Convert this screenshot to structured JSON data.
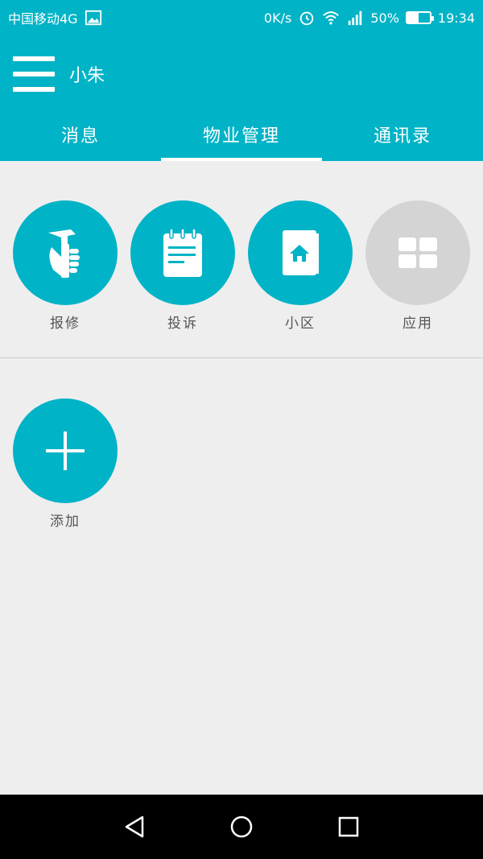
{
  "status_bar": {
    "carrier": "中国移动4G",
    "speed": "0K/s",
    "battery": "50%",
    "battery_level": 0.5,
    "time": "19:34"
  },
  "app_bar": {
    "title": "小朱",
    "tabs": [
      {
        "label": "消息",
        "active": false
      },
      {
        "label": "物业管理",
        "active": true
      },
      {
        "label": "通讯录",
        "active": false
      }
    ]
  },
  "grid": {
    "items": [
      {
        "label": "报修",
        "icon": "repair-hammer-icon"
      },
      {
        "label": "投诉",
        "icon": "notepad-icon"
      },
      {
        "label": "小区",
        "icon": "community-book-icon"
      },
      {
        "label": "应用",
        "icon": "apps-grid-icon"
      }
    ],
    "add": {
      "label": "添加",
      "icon": "plus-icon"
    }
  },
  "colors": {
    "primary": "#00b3c6",
    "background": "#eeeeee",
    "inactive_tile": "#d4d4d4"
  }
}
